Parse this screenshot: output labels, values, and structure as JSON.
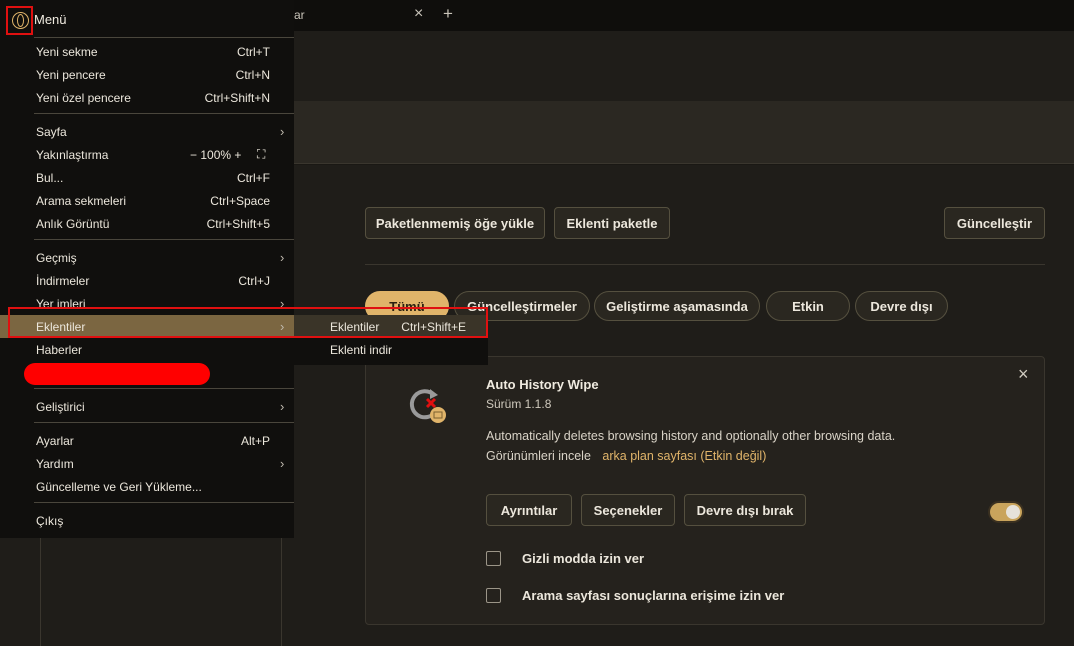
{
  "tabs": {
    "active_fragment": "ar",
    "close_glyph": "×",
    "new_glyph": "+"
  },
  "toolbar": {
    "load_unpacked": "Paketlenmemiş öğe yükle",
    "pack_extension": "Eklenti paketle",
    "update": "Güncelleştir"
  },
  "filters": [
    {
      "label": "Tümü",
      "active": true
    },
    {
      "label": "Güncelleştirmeler",
      "active": false
    },
    {
      "label": "Geliştirme aşamasında",
      "active": false
    },
    {
      "label": "Etkin",
      "active": false
    },
    {
      "label": "Devre dışı",
      "active": false
    }
  ],
  "extension": {
    "name": "Auto History Wipe",
    "version": "Sürüm 1.1.8",
    "description": "Automatically deletes browsing history and optionally other browsing data.",
    "views_label": "Görünümleri incele",
    "views_link": "arka plan sayfası (Etkin değil)",
    "details_button": "Ayrıntılar",
    "options_button": "Seçenekler",
    "disable_button": "Devre dışı bırak",
    "enabled": true,
    "incognito_label": "Gizli modda izin ver",
    "incognito_checked": false,
    "search_access_label": "Arama sayfası sonuçlarına erişime izin ver",
    "search_access_checked": false,
    "close_glyph": "×"
  },
  "menu": {
    "title": "Menü",
    "items": {
      "new_tab": {
        "label": "Yeni sekme",
        "shortcut": "Ctrl+T"
      },
      "new_window": {
        "label": "Yeni pencere",
        "shortcut": "Ctrl+N"
      },
      "new_private": {
        "label": "Yeni özel pencere",
        "shortcut": "Ctrl+Shift+N"
      },
      "page": {
        "label": "Sayfa"
      },
      "zoom": {
        "label": "Yakınlaştırma",
        "minus": "−",
        "value": "100%",
        "plus": "+",
        "fit": "⛶"
      },
      "find": {
        "label": "Bul...",
        "shortcut": "Ctrl+F"
      },
      "search_tabs": {
        "label": "Arama sekmeleri",
        "shortcut": "Ctrl+Space"
      },
      "snapshot": {
        "label": "Anlık Görüntü",
        "shortcut": "Ctrl+Shift+5"
      },
      "history": {
        "label": "Geçmiş"
      },
      "downloads": {
        "label": "İndirmeler",
        "shortcut": "Ctrl+J"
      },
      "bookmarks": {
        "label": "Yer imleri"
      },
      "extensions": {
        "label": "Eklentiler"
      },
      "news": {
        "label": "Haberler"
      },
      "developer": {
        "label": "Geliştirici"
      },
      "settings": {
        "label": "Ayarlar",
        "shortcut": "Alt+P"
      },
      "help": {
        "label": "Yardım"
      },
      "update_recovery": {
        "label": "Güncelleme ve Geri Yükleme..."
      },
      "exit": {
        "label": "Çıkış"
      }
    },
    "chevron": "›"
  },
  "submenu": {
    "extensions": {
      "label": "Eklentiler",
      "shortcut": "Ctrl+Shift+E"
    },
    "get_extensions": {
      "label": "Eklenti indir"
    }
  },
  "colors": {
    "accent": "#e0b46a",
    "highlight": "#7b6641",
    "annotation_red": "#e01010"
  }
}
